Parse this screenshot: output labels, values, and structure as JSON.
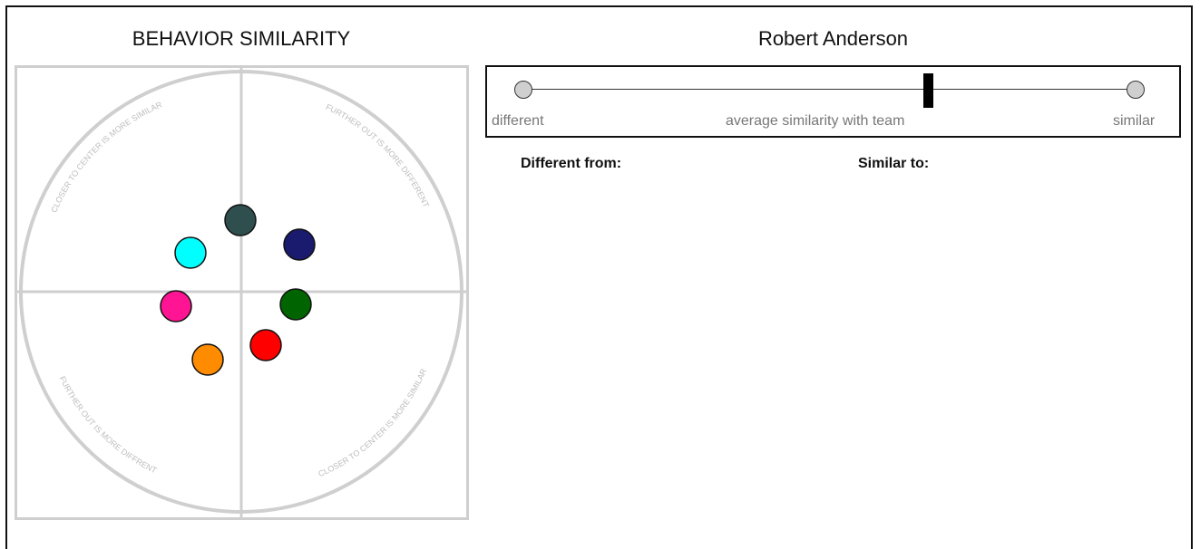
{
  "left_panel": {
    "title": "BEHAVIOR SIMILARITY",
    "captions": {
      "top_left": "CLOSER TO CENTER IS MORE SIMILAR",
      "top_right": "FURTHER OUT IS MORE DIFFERENT",
      "bottom_left": "FURTHER OUT IS MORE DIFFRENT",
      "bottom_right": "CLOSER TO CENTER IS MORE SIMILAR"
    },
    "members": [
      {
        "color": "#2f4f4f",
        "label": "dark-slate"
      },
      {
        "color": "#1a1a6e",
        "label": "navy"
      },
      {
        "color": "#00ffff",
        "label": "cyan"
      },
      {
        "color": "#ff1493",
        "label": "magenta"
      },
      {
        "color": "#006400",
        "label": "green"
      },
      {
        "color": "#ff0000",
        "label": "red"
      },
      {
        "color": "#ff8c00",
        "label": "orange"
      }
    ]
  },
  "right_panel": {
    "person_name": "Robert Anderson",
    "scale": {
      "left_label": "different",
      "center_label": "average similarity with team",
      "right_label": "similar",
      "marker_fraction": 0.66
    },
    "different_from_label": "Different from:",
    "similar_to_label": "Similar to:"
  }
}
